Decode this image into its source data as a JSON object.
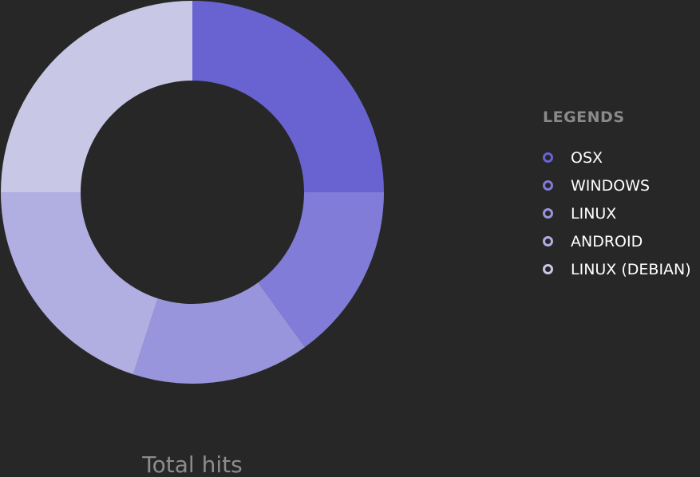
{
  "chart_data": {
    "type": "pie",
    "categories": [
      "OSX",
      "WINDOWS",
      "LINUX",
      "ANDROID",
      "LINUX (DEBIAN)"
    ],
    "values": [
      25,
      15,
      15,
      20,
      25
    ],
    "colors": [
      "#6963d2",
      "#807cd7",
      "#9995dd",
      "#b1aee2",
      "#c8c8e6"
    ],
    "donut": true,
    "start_angle": "top",
    "direction": "clockwise",
    "legend": "right"
  },
  "legend": {
    "title": "LEGENDS"
  },
  "footer": {
    "label": "Total hits"
  }
}
